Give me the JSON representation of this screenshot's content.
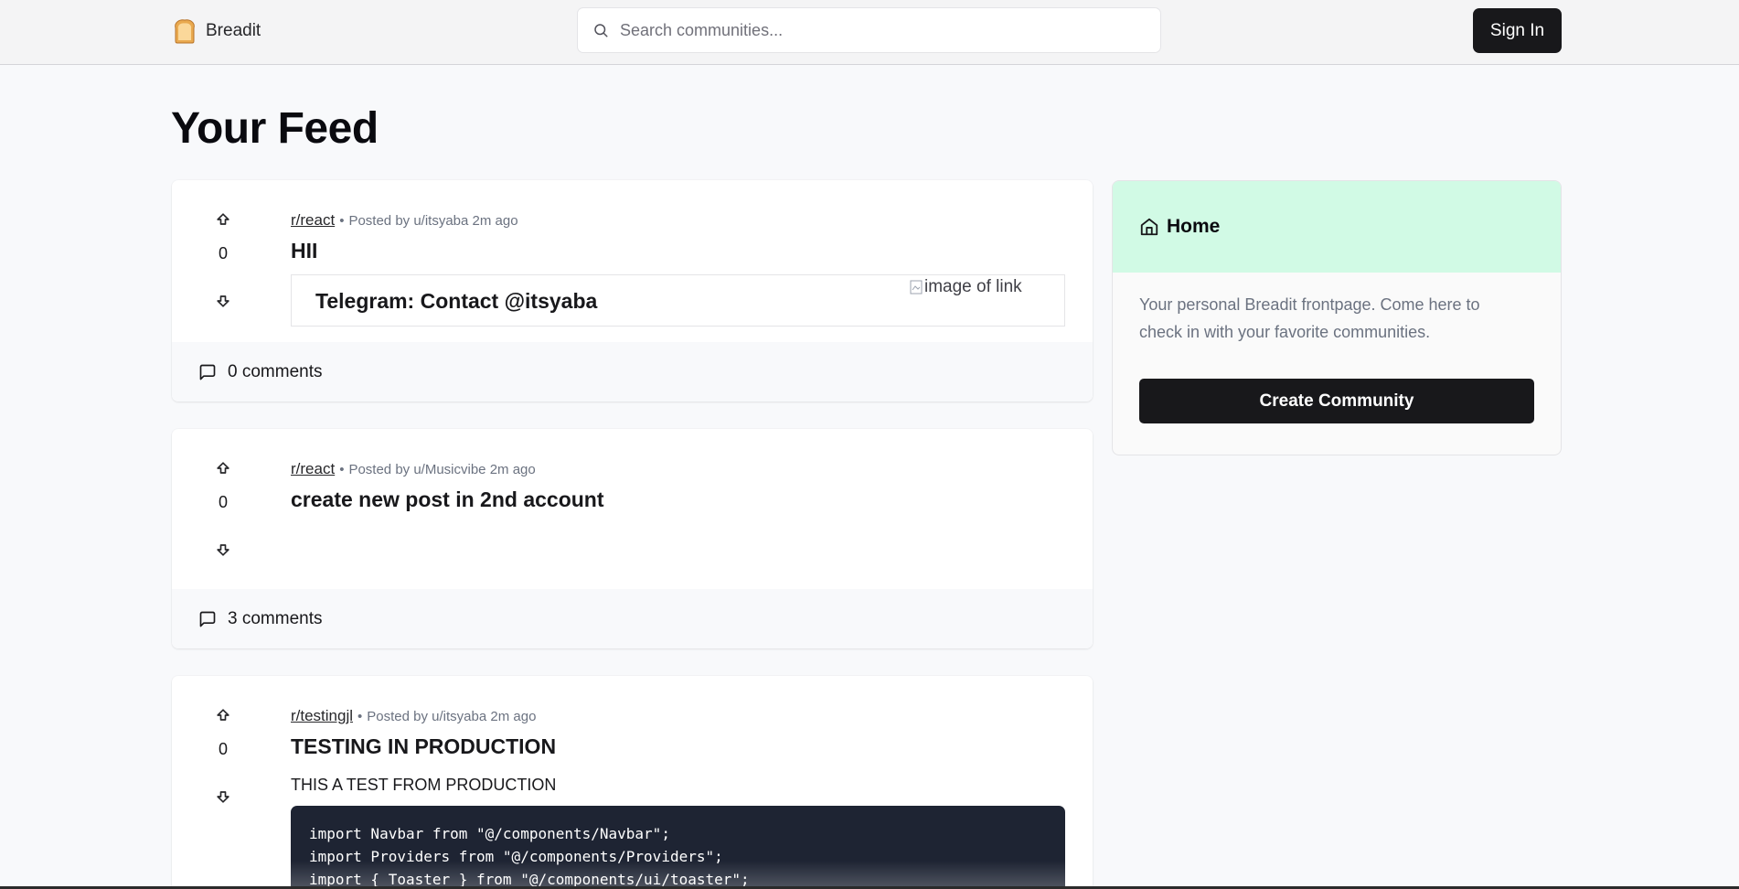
{
  "navbar": {
    "logo_text": "Breadit",
    "search_placeholder": "Search communities...",
    "signin_label": "Sign In"
  },
  "page_title": "Your Feed",
  "posts": [
    {
      "subreddit": "r/react",
      "posted_by": "Posted by u/itsyaba 2m ago",
      "votes": "0",
      "title": "HII",
      "link_title": "Telegram: Contact @itsyaba",
      "link_image_alt": "image of link",
      "comments": "0 comments"
    },
    {
      "subreddit": "r/react",
      "posted_by": "Posted by u/Musicvibe 2m ago",
      "votes": "0",
      "title": "create new post in 2nd account",
      "comments": "3 comments"
    },
    {
      "subreddit": "r/testingjl",
      "posted_by": "Posted by u/itsyaba 2m ago",
      "votes": "0",
      "title": "TESTING IN PRODUCTION",
      "text": "THIS A TEST FROM PRODUCTION",
      "code": [
        "import Navbar from \"@/components/Navbar\";",
        "import Providers from \"@/components/Providers\";",
        "import { Toaster } from \"@/components/ui/toaster\";"
      ]
    }
  ],
  "sidebar": {
    "title": "Home",
    "description": "Your personal Breadit frontpage. Come here to check in with your favorite communities.",
    "button_label": "Create Community"
  },
  "colors": {
    "accent_dark": "#18181b",
    "sidebar_header": "#d1fae5",
    "page_bg": "#f8f9fb"
  }
}
